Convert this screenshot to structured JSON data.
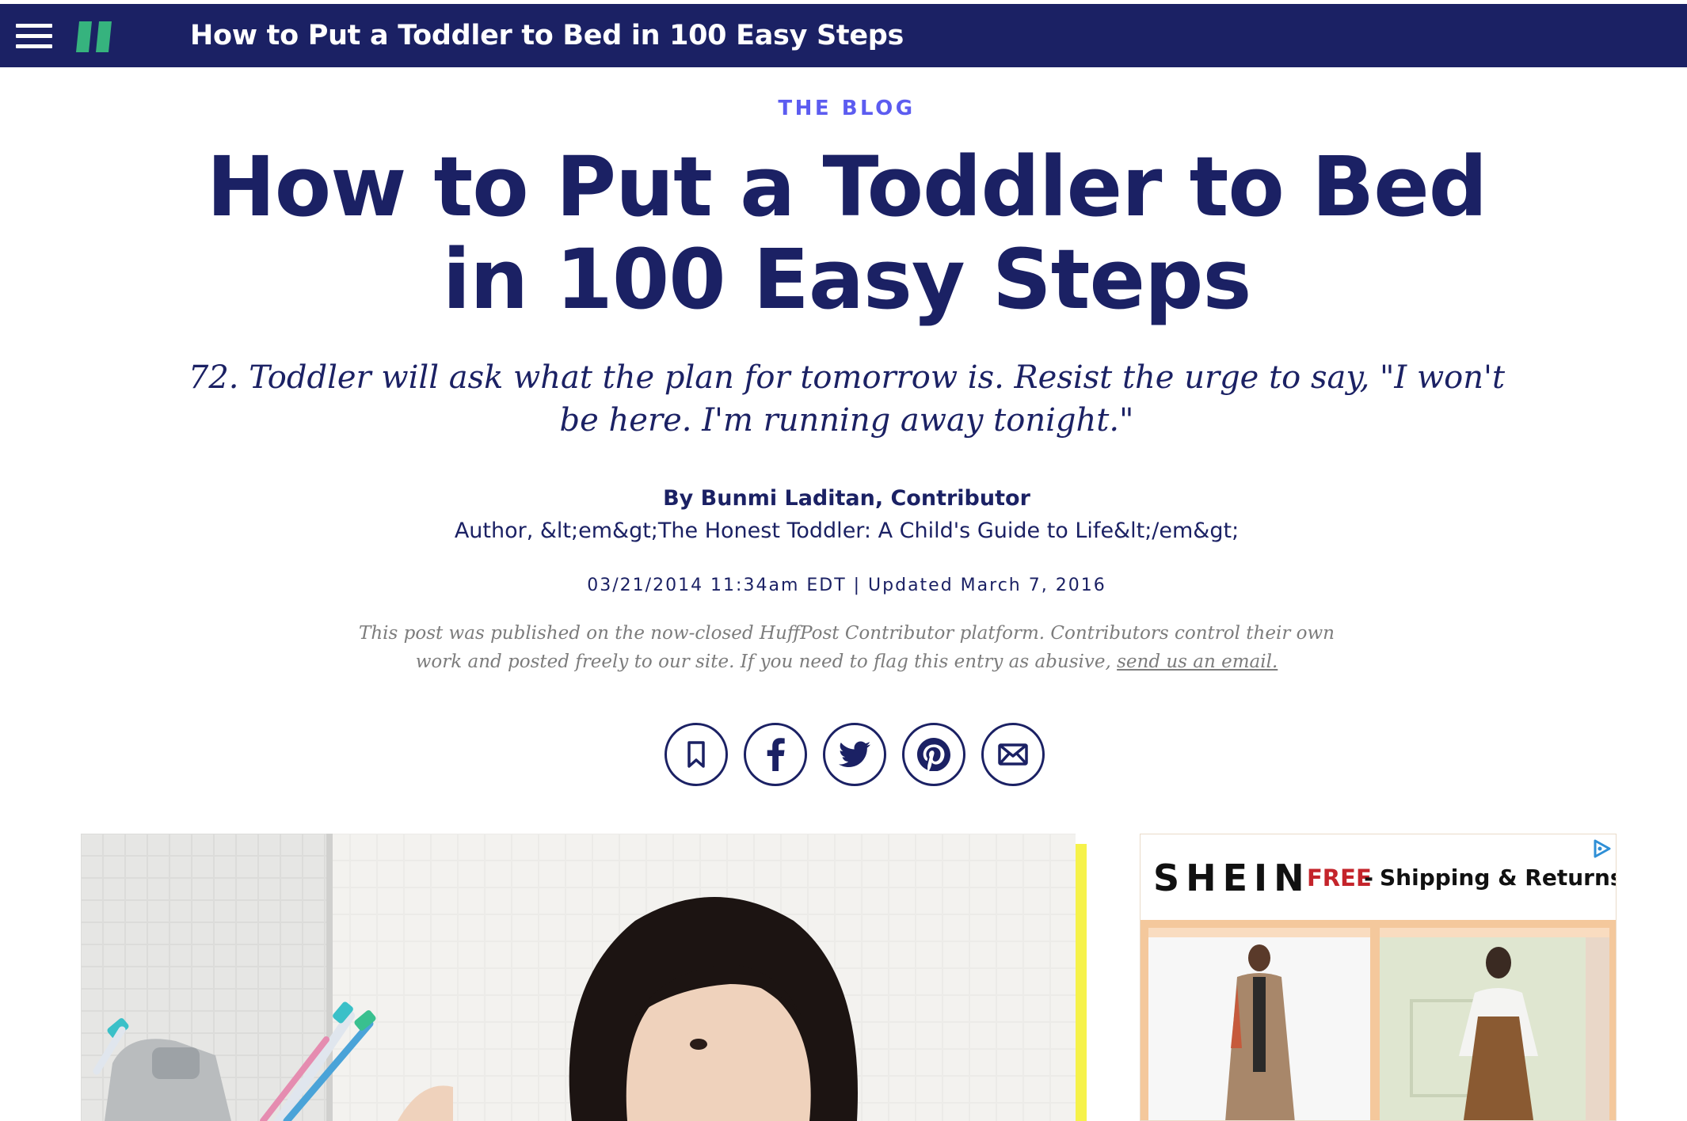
{
  "topbar": {
    "title": "How to Put a Toddler to Bed in 100 Easy Steps",
    "menu_icon": "hamburger-menu-icon",
    "logo_icon": "huffpost-logo-icon",
    "background_color": "#1b2164",
    "logo_color": "#36b37e"
  },
  "article": {
    "section": "THE BLOG",
    "headline_line1": "How to Put a Toddler to Bed",
    "headline_line2": "in 100 Easy Steps",
    "dek": "72. Toddler will ask what the plan for tomorrow is. Resist the urge to say, \"I won't be here. I'm running away tonight.\"",
    "byline": "By Bunmi Laditan, Contributor",
    "author_desc": "Author, &lt;em&gt;The Honest Toddler: A Child's Guide to Life&lt;/em&gt;",
    "timestamp": "03/21/2014 11:34am EDT | Updated March 7, 2016",
    "disclaimer_text": "This post was published on the now-closed HuffPost Contributor platform. Contributors control their own work and posted freely to our site. If you need to flag this entry as abusive,",
    "disclaimer_link": "send us an email."
  },
  "share": {
    "icons": [
      "bookmark-icon",
      "facebook-icon",
      "twitter-icon",
      "pinterest-icon",
      "email-icon"
    ]
  },
  "lead_image": {
    "icon": "toddler-brushing-teeth-photo"
  },
  "ad": {
    "brand": "SHEIN",
    "free_label": "FREE",
    "dash": "-",
    "shipping_label": "Shipping & Returns",
    "accent_color": "#c4242b",
    "choices_icon": "adchoices-icon"
  },
  "colors": {
    "navy": "#1b2164",
    "section_accent": "#5c5cf0",
    "highlight_yellow": "#f6f24a"
  }
}
